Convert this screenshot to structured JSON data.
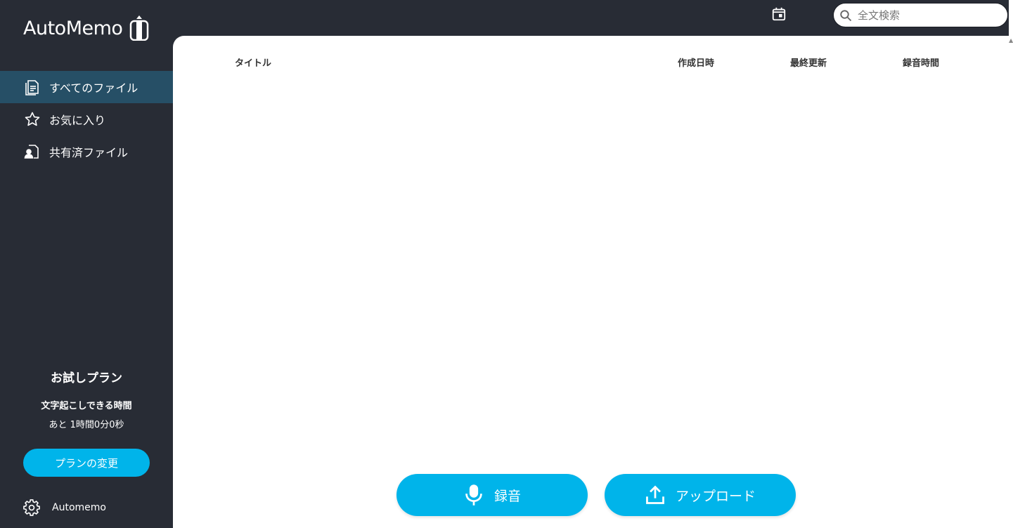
{
  "app": {
    "logo_text": "AutoMemo",
    "accent_color": "#00b4ea",
    "sidebar_bg": "#282c35",
    "active_bg": "#264f66"
  },
  "sidebar": {
    "items": [
      {
        "label": "すべてのファイル",
        "icon": "document-list-icon",
        "active": true
      },
      {
        "label": "お気に入り",
        "icon": "star-icon",
        "active": false
      },
      {
        "label": "共有済ファイル",
        "icon": "shared-file-icon",
        "active": false
      }
    ]
  },
  "plan": {
    "title": "お試しプラン",
    "label": "文字起こしできる時間",
    "remaining": "あと 1時間0分0秒",
    "button_label": "プランの変更"
  },
  "account": {
    "name": "Automemo",
    "icon": "gear-icon"
  },
  "topbar": {
    "calendar_icon": "calendar-icon",
    "search": {
      "placeholder": "全文検索",
      "value": "",
      "icon": "search-icon"
    }
  },
  "table": {
    "columns": [
      "タイトル",
      "作成日時",
      "最終更新",
      "録音時間"
    ],
    "rows": []
  },
  "actions": {
    "record_label": "録音",
    "record_icon": "microphone-icon",
    "upload_label": "アップロード",
    "upload_icon": "upload-icon"
  }
}
